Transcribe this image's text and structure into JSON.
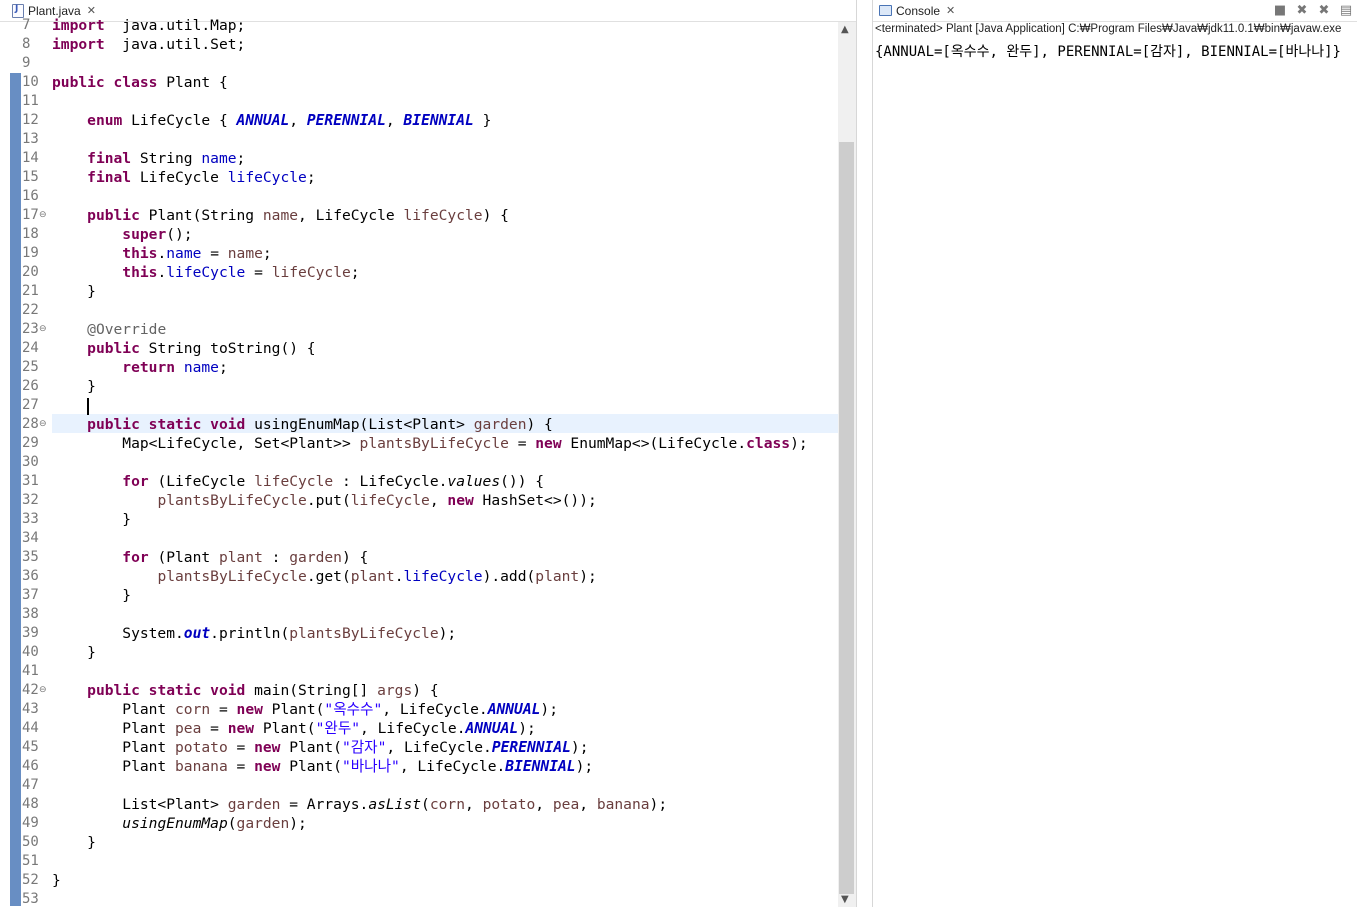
{
  "editor": {
    "tab_label": "Plant.java",
    "lines": [
      {
        "no": "7",
        "tokens": [
          [
            "kw",
            "import"
          ],
          [
            "",
            "  java.util.Map;"
          ]
        ]
      },
      {
        "no": "8",
        "tokens": [
          [
            "kw",
            "import"
          ],
          [
            "",
            "  java.util.Set;"
          ]
        ]
      },
      {
        "no": "9",
        "tokens": []
      },
      {
        "no": "10",
        "tokens": [
          [
            "kw",
            "public class"
          ],
          [
            "",
            " Plant {"
          ]
        ]
      },
      {
        "no": "11",
        "tokens": []
      },
      {
        "no": "12",
        "tokens": [
          [
            "",
            "    "
          ],
          [
            "kw",
            "enum"
          ],
          [
            "",
            " LifeCycle { "
          ],
          [
            "sfld",
            "ANNUAL"
          ],
          [
            "",
            ", "
          ],
          [
            "sfld",
            "PERENNIAL"
          ],
          [
            "",
            ", "
          ],
          [
            "sfld",
            "BIENNIAL"
          ],
          [
            "",
            " }"
          ]
        ]
      },
      {
        "no": "13",
        "tokens": []
      },
      {
        "no": "14",
        "tokens": [
          [
            "",
            "    "
          ],
          [
            "kw",
            "final"
          ],
          [
            "",
            " String "
          ],
          [
            "fld",
            "name"
          ],
          [
            "",
            ";"
          ]
        ]
      },
      {
        "no": "15",
        "tokens": [
          [
            "",
            "    "
          ],
          [
            "kw",
            "final"
          ],
          [
            "",
            " LifeCycle "
          ],
          [
            "fld",
            "lifeCycle"
          ],
          [
            "",
            ";"
          ]
        ]
      },
      {
        "no": "16",
        "tokens": []
      },
      {
        "no": "17",
        "fold": "⊖",
        "tokens": [
          [
            "",
            "    "
          ],
          [
            "kw",
            "public"
          ],
          [
            "",
            " Plant(String "
          ],
          [
            "var",
            "name"
          ],
          [
            "",
            ", LifeCycle "
          ],
          [
            "var",
            "lifeCycle"
          ],
          [
            "",
            ") {"
          ]
        ]
      },
      {
        "no": "18",
        "tokens": [
          [
            "",
            "        "
          ],
          [
            "kw",
            "super"
          ],
          [
            "",
            "();"
          ]
        ]
      },
      {
        "no": "19",
        "tokens": [
          [
            "",
            "        "
          ],
          [
            "kw",
            "this"
          ],
          [
            "",
            "."
          ],
          [
            "fld",
            "name"
          ],
          [
            "",
            " = "
          ],
          [
            "var",
            "name"
          ],
          [
            "",
            ";"
          ]
        ]
      },
      {
        "no": "20",
        "tokens": [
          [
            "",
            "        "
          ],
          [
            "kw",
            "this"
          ],
          [
            "",
            "."
          ],
          [
            "fld",
            "lifeCycle"
          ],
          [
            "",
            " = "
          ],
          [
            "var",
            "lifeCycle"
          ],
          [
            "",
            ";"
          ]
        ]
      },
      {
        "no": "21",
        "tokens": [
          [
            "",
            "    }"
          ]
        ]
      },
      {
        "no": "22",
        "tokens": []
      },
      {
        "no": "23",
        "fold": "⊖",
        "tokens": [
          [
            "",
            "    "
          ],
          [
            "ann",
            "@Override"
          ]
        ]
      },
      {
        "no": "24",
        "tokens": [
          [
            "",
            "    "
          ],
          [
            "kw",
            "public"
          ],
          [
            "",
            " String toString() {"
          ]
        ]
      },
      {
        "no": "25",
        "tokens": [
          [
            "",
            "        "
          ],
          [
            "kw",
            "return"
          ],
          [
            "",
            " "
          ],
          [
            "fld",
            "name"
          ],
          [
            "",
            ";"
          ]
        ]
      },
      {
        "no": "26",
        "tokens": [
          [
            "",
            "    }"
          ]
        ]
      },
      {
        "no": "27",
        "caret": true,
        "tokens": [
          [
            "",
            "    "
          ]
        ]
      },
      {
        "no": "28",
        "fold": "⊖",
        "tokens": [
          [
            "",
            "    "
          ],
          [
            "kw",
            "public static void"
          ],
          [
            "",
            " usingEnumMap(List<Plant> "
          ],
          [
            "var",
            "garden"
          ],
          [
            "",
            ") {"
          ]
        ]
      },
      {
        "no": "29",
        "tokens": [
          [
            "",
            "        Map<LifeCycle, Set<Plant>> "
          ],
          [
            "var",
            "plantsByLifeCycle"
          ],
          [
            "",
            " = "
          ],
          [
            "kw",
            "new"
          ],
          [
            "",
            " EnumMap<>(LifeCycle."
          ],
          [
            "kw",
            "class"
          ],
          [
            "",
            ");"
          ]
        ]
      },
      {
        "no": "30",
        "tokens": []
      },
      {
        "no": "31",
        "tokens": [
          [
            "",
            "        "
          ],
          [
            "kw",
            "for"
          ],
          [
            "",
            " (LifeCycle "
          ],
          [
            "var",
            "lifeCycle"
          ],
          [
            "",
            " : LifeCycle."
          ],
          [
            "ital",
            "values"
          ],
          [
            "",
            "()) {"
          ]
        ]
      },
      {
        "no": "32",
        "tokens": [
          [
            "",
            "            "
          ],
          [
            "var",
            "plantsByLifeCycle"
          ],
          [
            "",
            ".put("
          ],
          [
            "var",
            "lifeCycle"
          ],
          [
            "",
            ", "
          ],
          [
            "kw",
            "new"
          ],
          [
            "",
            " HashSet<>());"
          ]
        ]
      },
      {
        "no": "33",
        "tokens": [
          [
            "",
            "        }"
          ]
        ]
      },
      {
        "no": "34",
        "tokens": []
      },
      {
        "no": "35",
        "tokens": [
          [
            "",
            "        "
          ],
          [
            "kw",
            "for"
          ],
          [
            "",
            " (Plant "
          ],
          [
            "var",
            "plant"
          ],
          [
            "",
            " : "
          ],
          [
            "var",
            "garden"
          ],
          [
            "",
            ") {"
          ]
        ]
      },
      {
        "no": "36",
        "tokens": [
          [
            "",
            "            "
          ],
          [
            "var",
            "plantsByLifeCycle"
          ],
          [
            "",
            ".get("
          ],
          [
            "var",
            "plant"
          ],
          [
            "",
            "."
          ],
          [
            "fld",
            "lifeCycle"
          ],
          [
            "",
            ").add("
          ],
          [
            "var",
            "plant"
          ],
          [
            "",
            ");"
          ]
        ]
      },
      {
        "no": "37",
        "tokens": [
          [
            "",
            "        }"
          ]
        ]
      },
      {
        "no": "38",
        "tokens": []
      },
      {
        "no": "39",
        "tokens": [
          [
            "",
            "        System."
          ],
          [
            "sfld",
            "out"
          ],
          [
            "",
            ".println("
          ],
          [
            "var",
            "plantsByLifeCycle"
          ],
          [
            "",
            ");"
          ]
        ]
      },
      {
        "no": "40",
        "tokens": [
          [
            "",
            "    }"
          ]
        ]
      },
      {
        "no": "41",
        "tokens": []
      },
      {
        "no": "42",
        "fold": "⊖",
        "tokens": [
          [
            "",
            "    "
          ],
          [
            "kw",
            "public static void"
          ],
          [
            "",
            " main(String[] "
          ],
          [
            "var",
            "args"
          ],
          [
            "",
            ") {"
          ]
        ]
      },
      {
        "no": "43",
        "tokens": [
          [
            "",
            "        Plant "
          ],
          [
            "var",
            "corn"
          ],
          [
            "",
            " = "
          ],
          [
            "kw",
            "new"
          ],
          [
            "",
            " Plant("
          ],
          [
            "str",
            "\"옥수수\""
          ],
          [
            "",
            ", LifeCycle."
          ],
          [
            "sfld",
            "ANNUAL"
          ],
          [
            "",
            ");"
          ]
        ]
      },
      {
        "no": "44",
        "tokens": [
          [
            "",
            "        Plant "
          ],
          [
            "var",
            "pea"
          ],
          [
            "",
            " = "
          ],
          [
            "kw",
            "new"
          ],
          [
            "",
            " Plant("
          ],
          [
            "str",
            "\"완두\""
          ],
          [
            "",
            ", LifeCycle."
          ],
          [
            "sfld",
            "ANNUAL"
          ],
          [
            "",
            ");"
          ]
        ]
      },
      {
        "no": "45",
        "tokens": [
          [
            "",
            "        Plant "
          ],
          [
            "var",
            "potato"
          ],
          [
            "",
            " = "
          ],
          [
            "kw",
            "new"
          ],
          [
            "",
            " Plant("
          ],
          [
            "str",
            "\"감자\""
          ],
          [
            "",
            ", LifeCycle."
          ],
          [
            "sfld",
            "PERENNIAL"
          ],
          [
            "",
            ");"
          ]
        ]
      },
      {
        "no": "46",
        "tokens": [
          [
            "",
            "        Plant "
          ],
          [
            "var",
            "banana"
          ],
          [
            "",
            " = "
          ],
          [
            "kw",
            "new"
          ],
          [
            "",
            " Plant("
          ],
          [
            "str",
            "\"바나나\""
          ],
          [
            "",
            ", LifeCycle."
          ],
          [
            "sfld",
            "BIENNIAL"
          ],
          [
            "",
            ");"
          ]
        ]
      },
      {
        "no": "47",
        "tokens": []
      },
      {
        "no": "48",
        "tokens": [
          [
            "",
            "        List<Plant> "
          ],
          [
            "var",
            "garden"
          ],
          [
            "",
            " = Arrays."
          ],
          [
            "ital",
            "asList"
          ],
          [
            "",
            "("
          ],
          [
            "var",
            "corn"
          ],
          [
            "",
            ", "
          ],
          [
            "var",
            "potato"
          ],
          [
            "",
            ", "
          ],
          [
            "var",
            "pea"
          ],
          [
            "",
            ", "
          ],
          [
            "var",
            "banana"
          ],
          [
            "",
            ");"
          ]
        ]
      },
      {
        "no": "49",
        "tokens": [
          [
            "",
            "        "
          ],
          [
            "ital",
            "usingEnumMap"
          ],
          [
            "",
            "("
          ],
          [
            "var",
            "garden"
          ],
          [
            "",
            ");"
          ]
        ]
      },
      {
        "no": "50",
        "tokens": [
          [
            "",
            "    }"
          ]
        ]
      },
      {
        "no": "51",
        "tokens": []
      },
      {
        "no": "52",
        "tokens": [
          [
            "",
            "}"
          ]
        ]
      },
      {
        "no": "53",
        "tokens": []
      }
    ]
  },
  "console": {
    "tab_label": "Console",
    "status": "<terminated> Plant [Java Application] C:₩Program Files₩Java₩jdk11.0.1₩bin₩javaw.exe",
    "output": "{ANNUAL=[옥수수, 완두], PERENNIAL=[감자], BIENNIAL=[바나나]}",
    "toolbar_icons": [
      "terminate-icon",
      "remove-launch-icon",
      "remove-all-terminated-icon",
      "clear-console-icon"
    ]
  },
  "colors": {
    "keyword": "#7f0055",
    "field": "#0000c0",
    "local_var": "#6a3e3e",
    "string": "#2a00ff",
    "annotation": "#646464",
    "current_line": "#e8f2fe",
    "change_bar": "#4d7ab9"
  }
}
